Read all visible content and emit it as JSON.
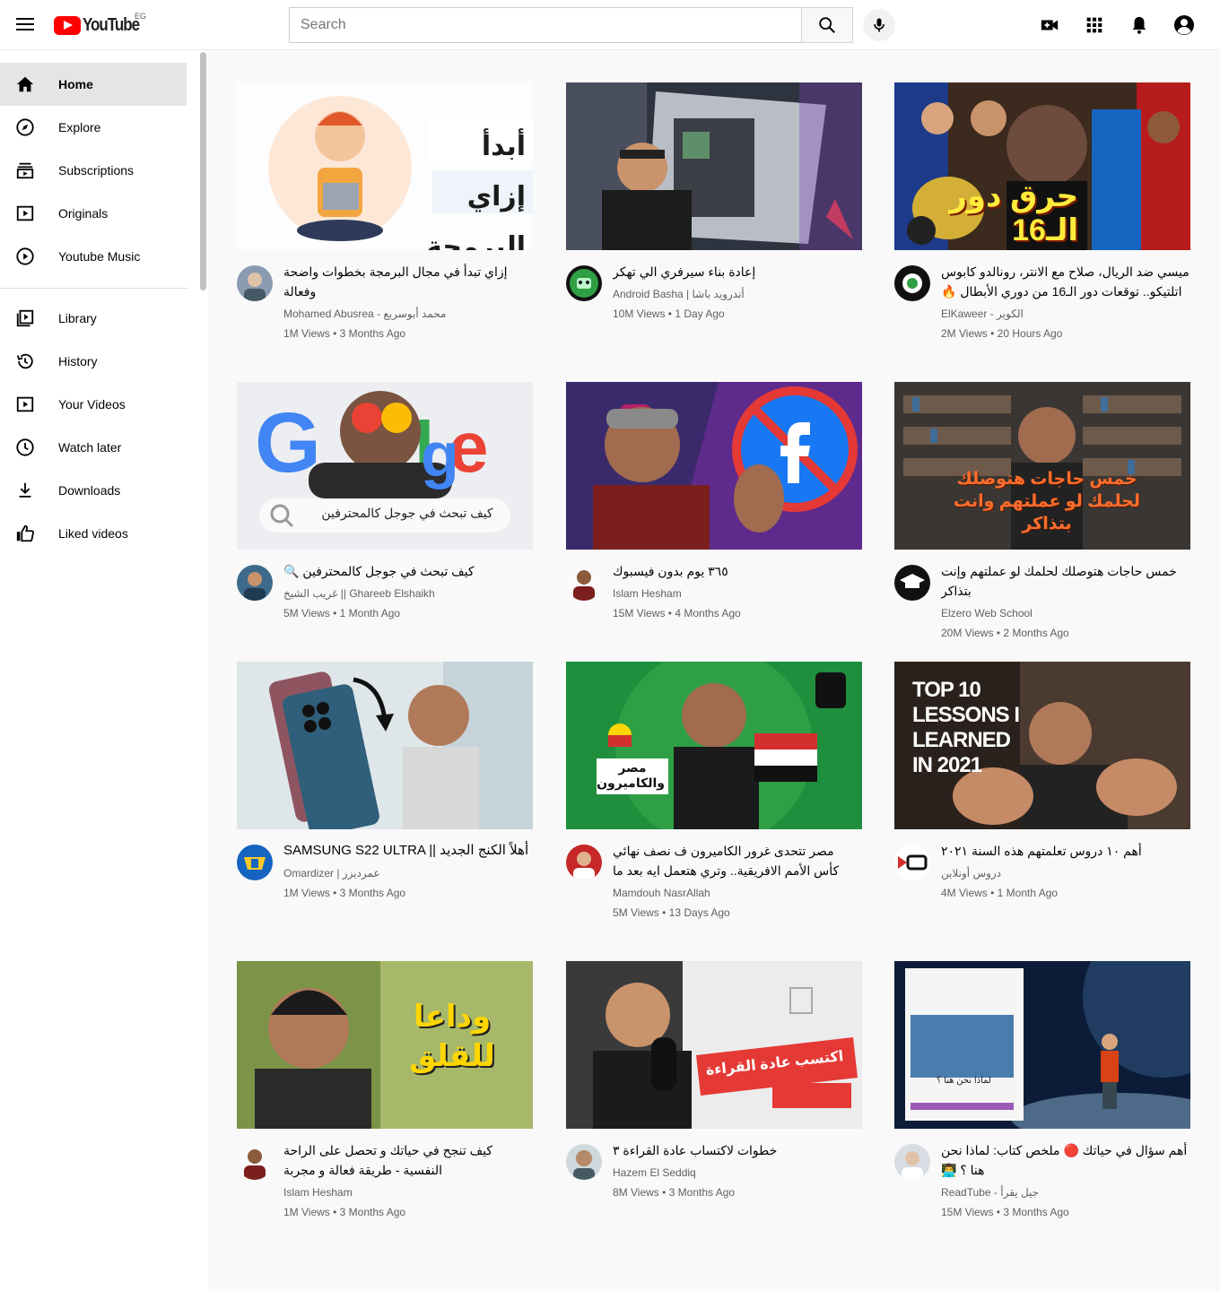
{
  "header": {
    "logo_text": "YouTube",
    "country_code": "EG",
    "search_placeholder": "Search"
  },
  "sidebar": {
    "items": [
      {
        "label": "Home",
        "icon": "home-icon",
        "active": true
      },
      {
        "label": "Explore",
        "icon": "compass-icon"
      },
      {
        "label": "Subscriptions",
        "icon": "subscriptions-icon"
      },
      {
        "label": "Originals",
        "icon": "originals-icon"
      },
      {
        "label": "Youtube Music",
        "icon": "music-icon"
      },
      {
        "label": "Library",
        "icon": "library-icon"
      },
      {
        "label": "History",
        "icon": "history-icon"
      },
      {
        "label": "Your Videos",
        "icon": "your-videos-icon"
      },
      {
        "label": "Watch later",
        "icon": "clock-icon"
      },
      {
        "label": "Downloads",
        "icon": "download-icon"
      },
      {
        "label": "Liked videos",
        "icon": "thumbs-up-icon"
      }
    ]
  },
  "videos": [
    {
      "title": "إزاي تبدأ في مجال البرمجة بخطوات واضحة وفعالة",
      "channel": "Mohamed Abusrea - محمد أبوسريع",
      "stats": "1M Views • 3 Months Ago",
      "thumb_text": "أبدأ إزاي البرمجة",
      "avatar_color": "#8a9bb0"
    },
    {
      "title": "إعادة بناء سيرفري الي تهكر",
      "channel": "Android Basha | أندرويد باشا",
      "stats": "10M Views • 1 Day Ago",
      "thumb_text": "",
      "avatar_color": "#2f9e44"
    },
    {
      "title": "ميسي ضد الريال، صلاح مع الانتر، رونالدو كابوس اتلتيكو.. توقعات دور الـ16 من دوري الأبطال 🔥 ...",
      "channel": "ElKaweer - الكوير",
      "stats": "2M Views • 20 Hours Ago",
      "thumb_text": "حرق دور الـ16",
      "avatar_color": "#111111"
    },
    {
      "title": "كيف تبحث في جوجل كالمحترفين 🔍",
      "channel": "غريب الشيخ || Ghareeb Elshaikh",
      "stats": "5M Views • 1 Month Ago",
      "thumb_text": "كيف تبحث في جوجل كالمحترفين",
      "avatar_color": "#3d6a8a"
    },
    {
      "title": "٣٦٥ يوم بدون فيسبوك",
      "channel": "Islam Hesham",
      "stats": "15M Views • 4 Months Ago",
      "thumb_text": "",
      "avatar_color": "#6b4a3a"
    },
    {
      "title": "خمس حاجات هتوصلك لحلمك لو عملتهم وإنت بتذاكر",
      "channel": "Elzero Web School",
      "stats": "20M Views • 2 Months Ago",
      "thumb_text": "خمس حاجات هتوصلك لحلمك لو عملتهم وانت بتذاكر",
      "avatar_color": "#111111"
    },
    {
      "title": "SAMSUNG S22 ULTRA || أهلاً الكنج الجديد",
      "channel": "Omardizer | عمرديزر",
      "stats": "1M Views • 3 Months Ago",
      "thumb_text": "",
      "avatar_color": "#1565c0"
    },
    {
      "title": "مصر تتحدى غرور الكاميرون ف نصف نهائي كأس الأمم الافريقية.. وتري هتعمل ايه بعد ما عيروا الملعب و...",
      "channel": "Mamdouh NasrAllah",
      "stats": "5M Views • 13 Days Ago",
      "thumb_text": "مصر والكاميرون",
      "avatar_color": "#c62828"
    },
    {
      "title": "أهم ١٠ دروس تعلمتهم هذه السنة ٢٠٢١",
      "channel": "دروس أونلاين",
      "stats": "4M Views • 1 Month Ago",
      "thumb_text": "TOP 10 LESSONS I LEARNED IN 2021",
      "avatar_color": "#ffffff"
    },
    {
      "title": "كيف تنجح في حياتك و تحصل على الراحة النفسية - طريقة فعالة و مجربة",
      "channel": "Islam Hesham",
      "stats": "1M Views • 3 Months Ago",
      "thumb_text": "وداعا للقلق",
      "avatar_color": "#6b4a3a"
    },
    {
      "title": "خطوات لاكتساب عادة القراءة ٣",
      "channel": "Hazem El Seddiq",
      "stats": "8M Views • 3 Months Ago",
      "thumb_text": "اكتسب عادة القراءة",
      "avatar_color": "#b58a6a"
    },
    {
      "title": "أهم سؤال في حياتك 🔴 ملخص كتاب: لماذا نحن هنا ؟ 👨‍💻",
      "channel": "ReadTube - جيل يقرأ",
      "stats": "15M Views • 3 Months Ago",
      "thumb_text": "لماذا نحن هنا ؟",
      "avatar_color": "#d8dde3"
    }
  ]
}
